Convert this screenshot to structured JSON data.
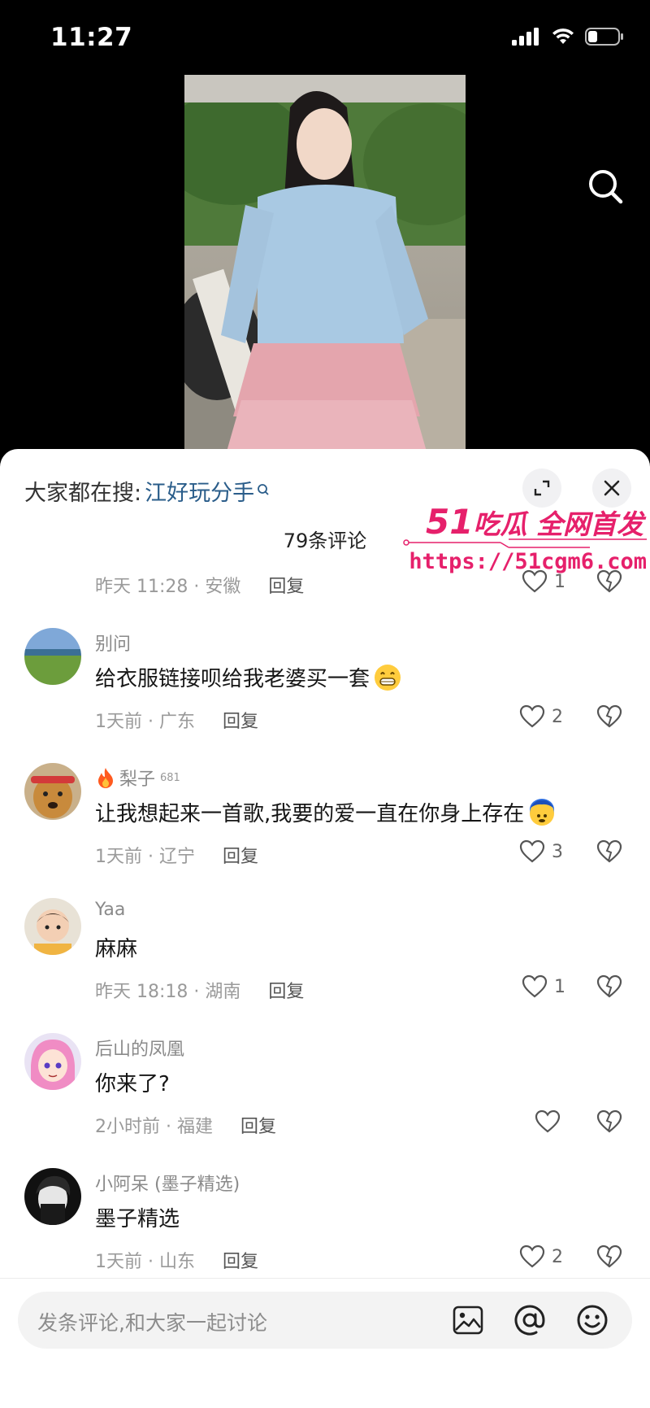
{
  "status_bar": {
    "time": "11:27"
  },
  "sheet": {
    "suggest_prefix": "大家都在搜:",
    "suggest_term": "江好玩分手",
    "comment_count": "79条评论"
  },
  "watermark": {
    "line1_num": "51",
    "line1_text": "吃瓜 全网首发",
    "line2": "https://51cgm6.com"
  },
  "comments": [
    {
      "user": "",
      "text": "",
      "time_location": "昨天 11:28 · 安徽",
      "reply": "回复",
      "likes": "1"
    },
    {
      "user": "别问",
      "text": "给衣服链接呗给我老婆买一套",
      "time_location": "1天前 · 广东",
      "reply": "回复",
      "likes": "2"
    },
    {
      "user": "梨子",
      "badge": "681",
      "text": "让我想起来一首歌,我要的爱一直在你身上存在",
      "time_location": "1天前 · 辽宁",
      "reply": "回复",
      "likes": "3"
    },
    {
      "user": "Yaa",
      "text": "麻麻",
      "time_location": "昨天 18:18 · 湖南",
      "reply": "回复",
      "likes": "1"
    },
    {
      "user": "后山的凤凰",
      "text": "你来了?",
      "time_location": "2小时前 · 福建",
      "reply": "回复",
      "likes": ""
    },
    {
      "user": "小阿呆 (墨子精选)",
      "text": "墨子精选",
      "time_location": "1天前 · 山东",
      "reply": "回复",
      "likes": "2"
    }
  ],
  "input": {
    "placeholder": "发条评论,和大家一起讨论"
  },
  "colors": {
    "accent": "#2a5d8a",
    "watermark": "#e6206b",
    "background": "#000000",
    "sheet": "#ffffff"
  },
  "icons": [
    "signal-icon",
    "wifi-icon",
    "battery-icon",
    "search-icon",
    "expand-icon",
    "close-icon",
    "heart-icon",
    "dislike-icon",
    "image-icon",
    "at-icon",
    "emoji-icon"
  ]
}
